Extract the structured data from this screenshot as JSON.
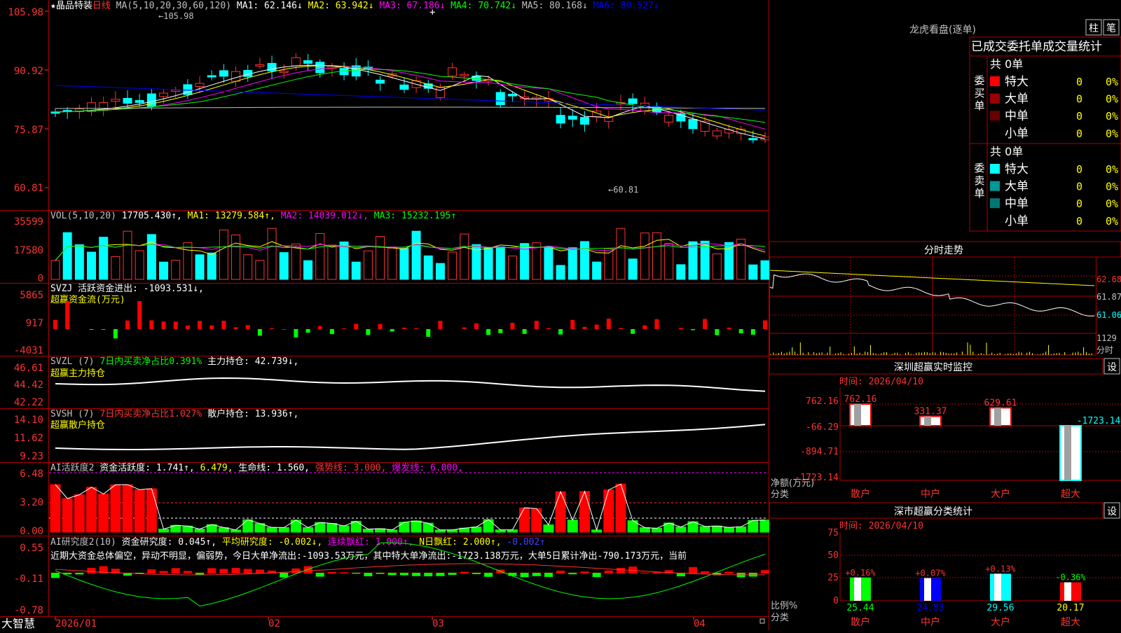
{
  "main": {
    "title": "★晶品特装",
    "period": "日线",
    "ma_header": "MA(5,10,20,30,60,120)",
    "ma_items": [
      {
        "text": "MA1: 62.146↓",
        "color": "#ffffff"
      },
      {
        "text": "MA2: 63.942↓",
        "color": "#ffff00"
      },
      {
        "text": "MA3: 67.186↓",
        "color": "#ff00ff"
      },
      {
        "text": "MA4: 70.742↓",
        "color": "#00ff00"
      },
      {
        "text": "MA5: 80.168↓",
        "color": "#c0c0c0"
      },
      {
        "text": "MA6: 80.527↓",
        "color": "#0000ff"
      }
    ],
    "yticks": [
      "105.98",
      "90.92",
      "75.87",
      "60.81"
    ],
    "high_label": "←105.98",
    "low_label": "←60.81"
  },
  "vol": {
    "header": "VOL(5,10,20)",
    "items": [
      {
        "text": "17705.430↑,",
        "color": "#ffffff"
      },
      {
        "text": "MA1: 13279.584↑,",
        "color": "#ffff00"
      },
      {
        "text": "MA2: 14039.012↓,",
        "color": "#ff00ff"
      },
      {
        "text": "MA3: 15232.195↑",
        "color": "#00ff00"
      }
    ],
    "yticks": [
      "35599",
      "17580",
      "0"
    ]
  },
  "svzj": {
    "header": "SVZJ  活跃资金进出: -1093.531↓,",
    "sub": "超赢资金流(万元)",
    "yticks": [
      "5865",
      "917",
      "-4031"
    ]
  },
  "svzl": {
    "header_parts": [
      {
        "text": "SVZL (7)",
        "color": "#c0c0c0"
      },
      {
        "text": "7日内买卖净占比0.391%",
        "color": "#00ff00"
      },
      {
        "text": "主力持仓: 42.739↓,",
        "color": "#ffffff"
      }
    ],
    "sub": "超赢主力持仓",
    "yticks": [
      "46.61",
      "44.42",
      "42.22"
    ]
  },
  "svsh": {
    "header_parts": [
      {
        "text": "SVSH (7)",
        "color": "#c0c0c0"
      },
      {
        "text": "7日内买卖净占比1.027%",
        "color": "#ff3232"
      },
      {
        "text": "散户持仓: 13.936↑,",
        "color": "#ffffff"
      }
    ],
    "sub": "超赢散户持仓",
    "yticks": [
      "14.10",
      "11.62",
      "9.23"
    ]
  },
  "ai2": {
    "header_parts": [
      {
        "text": "AI活跃度2",
        "color": "#c0c0c0"
      },
      {
        "text": "资金活跃度: 1.741↑,",
        "color": "#ffffff"
      },
      {
        "text": "6.479,",
        "color": "#ffff00"
      },
      {
        "text": "生命线: 1.560,",
        "color": "#ffffff"
      },
      {
        "text": "强势线: 3.000,",
        "color": "#ff3232"
      },
      {
        "text": "爆发线: 6.000,",
        "color": "#ff00ff"
      }
    ],
    "yticks": [
      "6.48",
      "3.20",
      "0.00"
    ]
  },
  "ai_research": {
    "header_parts": [
      {
        "text": "AI研究度2(10)",
        "color": "#c0c0c0"
      },
      {
        "text": "资金研究度: 0.045↑,",
        "color": "#ffffff"
      },
      {
        "text": "平均研究度: -0.002↓,",
        "color": "#ffff00"
      },
      {
        "text": "连续飘红: 1.000↑,",
        "color": "#ff00ff"
      },
      {
        "text": "N日飘红: 2.000↑,",
        "color": "#ffff00"
      },
      {
        "text": "-0.002↑",
        "color": "#4040ff"
      }
    ],
    "note": "近期大资金总体偏空，异动不明显，偏弱势，今日大单净流出:-1093.53万元，其中特大单净流出:-1723.138万元，大单5日累计净出-790.173万元，当前",
    "yticks": [
      "0.55",
      "-0.11",
      "-0.78"
    ]
  },
  "xaxis": {
    "app_label": "大智慧",
    "labels": [
      "2026/01",
      "02",
      "03",
      "04"
    ]
  },
  "longhu": {
    "title": "龙虎看盘(逐单)",
    "btn_bar": "柱",
    "btn_pen": "笔",
    "subtitle": "已成交委托单成交量统计",
    "buy_label": "委买单",
    "sell_label": "委卖单",
    "buy_total": "共 0单",
    "sell_total": "共 0单",
    "buy_rows": [
      {
        "label": "特大",
        "count": "0",
        "pct": "0%",
        "color": "#ff0000"
      },
      {
        "label": "大单",
        "count": "0",
        "pct": "0%",
        "color": "#990000"
      },
      {
        "label": "中单",
        "count": "0",
        "pct": "0%",
        "color": "#660000"
      },
      {
        "label": "小单",
        "count": "0",
        "pct": "0%",
        "color": "#000000"
      }
    ],
    "sell_rows": [
      {
        "label": "特大",
        "count": "0",
        "pct": "0%",
        "color": "#00ffff"
      },
      {
        "label": "大单",
        "count": "0",
        "pct": "0%",
        "color": "#009999"
      },
      {
        "label": "中单",
        "count": "0",
        "pct": "0%",
        "color": "#007777"
      },
      {
        "label": "小单",
        "count": "0",
        "pct": "0%",
        "color": "#000000"
      }
    ]
  },
  "intraday": {
    "title": "分时走势",
    "prices": [
      "62.68",
      "61.87",
      "61.06"
    ],
    "vol_label": "1129",
    "bottom_label": "分时"
  },
  "monitor": {
    "title": "深圳超赢实时监控",
    "setting": "设",
    "time": "时间: 2026/04/10",
    "yticks": [
      "762.16",
      "-66.29",
      "-894.71",
      "-1723.14"
    ],
    "ylabel": "净额(万元)",
    "xlabel": "分类",
    "categories": [
      "散户",
      "中户",
      "大户",
      "超大"
    ],
    "values": [
      762.16,
      331.37,
      629.61,
      -1723.14
    ],
    "value_labels": [
      "762.16",
      "331.37",
      "629.61",
      "-1723.14"
    ]
  },
  "classify": {
    "title": "深市超赢分类统计",
    "setting": "设",
    "time": "时间: 2026/04/10",
    "yticks": [
      "75",
      "50",
      "25",
      "0"
    ],
    "ylabel": "比例%",
    "xlabel": "分类",
    "categories": [
      "散户",
      "中户",
      "大户",
      "超大"
    ],
    "values": [
      25.44,
      24.83,
      29.56,
      20.17
    ],
    "value_labels": [
      "25.44",
      "24.83",
      "29.56",
      "20.17"
    ],
    "changes": [
      "+0.16%",
      "+0.07%",
      "+0.13%",
      "-0.36%"
    ]
  },
  "chart_data": [
    {
      "type": "line",
      "title": "晶品特装 日线 MA(5,10,20,30,60,120)",
      "ylim": [
        60.81,
        105.98
      ],
      "series": [
        {
          "name": "MA1",
          "values": [
            62.146
          ]
        },
        {
          "name": "MA2",
          "values": [
            63.942
          ]
        },
        {
          "name": "MA3",
          "values": [
            67.186
          ]
        },
        {
          "name": "MA4",
          "values": [
            70.742
          ]
        },
        {
          "name": "MA5",
          "values": [
            80.168
          ]
        },
        {
          "name": "MA6",
          "values": [
            80.527
          ]
        }
      ]
    },
    {
      "type": "bar",
      "title": "深圳超赢实时监控",
      "categories": [
        "散户",
        "中户",
        "大户",
        "超大"
      ],
      "values": [
        762.16,
        331.37,
        629.61,
        -1723.14
      ],
      "ylabel": "净额(万元)",
      "ylim": [
        -1723.14,
        762.16
      ]
    },
    {
      "type": "bar",
      "title": "深市超赢分类统计",
      "categories": [
        "散户",
        "中户",
        "大户",
        "超大"
      ],
      "values": [
        25.44,
        24.83,
        29.56,
        20.17
      ],
      "ylabel": "比例%",
      "ylim": [
        0,
        75
      ]
    }
  ]
}
